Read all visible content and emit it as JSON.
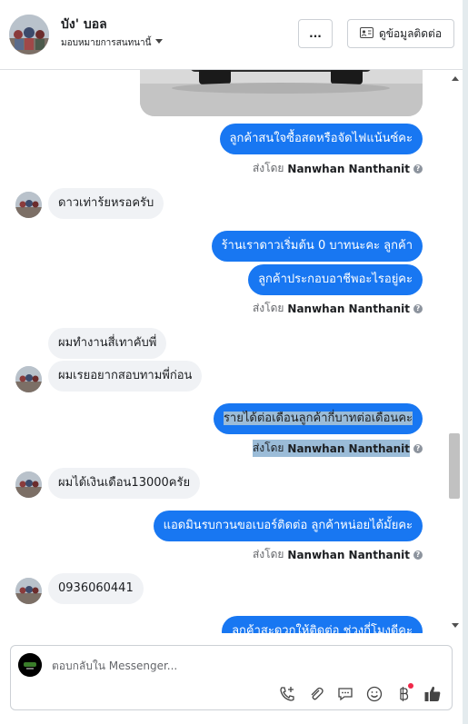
{
  "header": {
    "name": "บัง' บอล",
    "assign_label": "มอบหมายการสนทนานี้",
    "more_label": "...",
    "contact_label": "ดูข้อมูลติดต่อ"
  },
  "messages": {
    "m1": "ลูกค้าสนใจซื้อสดหรือจัดไฟแน้นซ์คะ",
    "m2": "ดาวเท่าร้ยหรอครับ",
    "m3": "ร้านเราดาวเริ่มต้น 0 บาทนะคะ ลูกค้า",
    "m4": "ลูกค้าประกอบอาชีพอะไรอยู่คะ",
    "m5": "ผมทำงานสี่เทาคับพี่",
    "m6": "ผมเรยอยากสอบทามพี่ก่อน",
    "m7": "รายได้ต่อเดือนลูกค้ากี่บาทต่อเดือนคะ",
    "m8": "ผมได้เงินเดือน13000ครัย",
    "m9": "แอดมินรบกวนขอเบอร์ติดต่อ ลูกค้าหน่อยได้มั้ยคะ",
    "m10": "0936060441",
    "m11": "ลูกค้าสะดวกให้ติดต่อ ช่วงกี่โมงดีคะ"
  },
  "sent_by": {
    "prefix": "ส่งโดย",
    "agent": "Nanwhan Nanthanit",
    "info": "?"
  },
  "composer": {
    "placeholder": "ตอบกลับใน Messenger..."
  },
  "icons": {
    "more": "more-dots-icon",
    "contact": "contact-card-icon",
    "call": "call-plus-icon",
    "attach": "paperclip-icon",
    "saved": "saved-replies-icon",
    "emoji": "emoji-icon",
    "payment": "payment-icon",
    "like": "thumbs-up-icon"
  },
  "colors": {
    "outgoing": "#1877f2",
    "incoming": "#f0f2f5",
    "highlight": "#9bbcd8"
  }
}
